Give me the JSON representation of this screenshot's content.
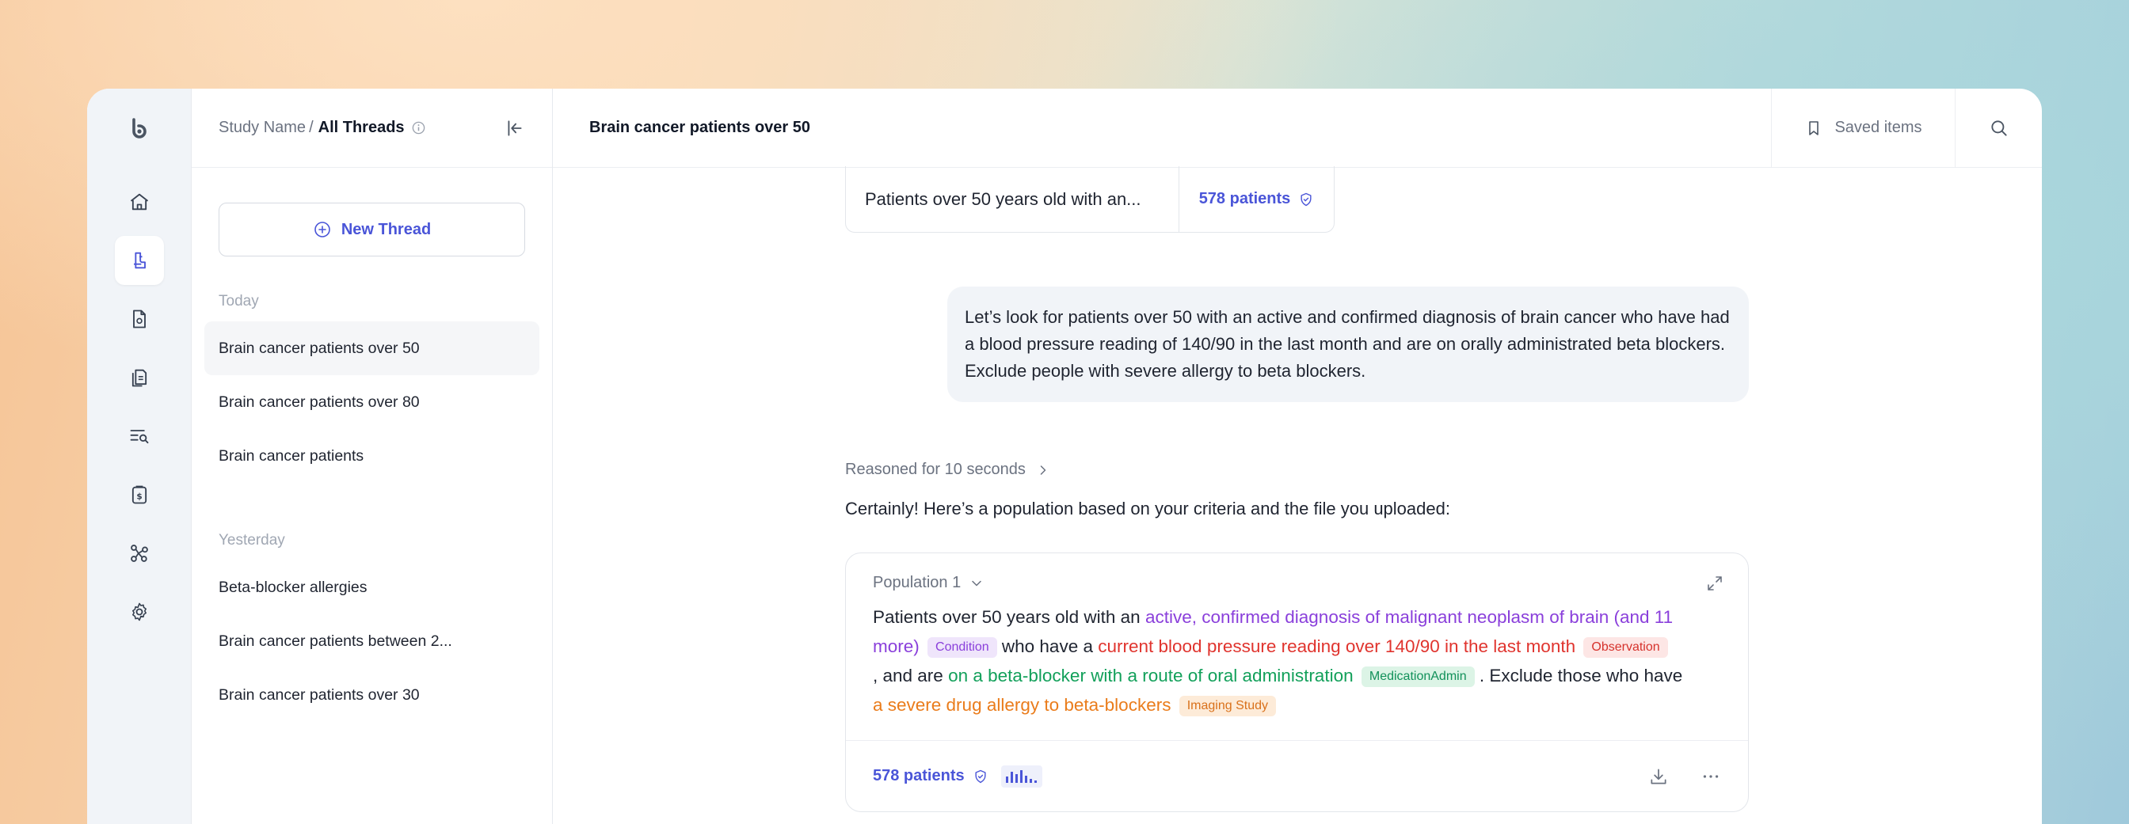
{
  "breadcrumb": {
    "study": "Study Name",
    "separator": "/",
    "current": "All Threads"
  },
  "threads": {
    "new_thread_label": "New Thread",
    "today_label": "Today",
    "yesterday_label": "Yesterday",
    "today": [
      {
        "label": "Brain cancer patients over 50"
      },
      {
        "label": "Brain cancer patients over 80"
      },
      {
        "label": "Brain cancer patients"
      }
    ],
    "yesterday": [
      {
        "label": "Beta-blocker allergies"
      },
      {
        "label": "Brain cancer patients between 2..."
      },
      {
        "label": "Brain cancer patients over 30"
      }
    ]
  },
  "header": {
    "title": "Brain cancer patients over 50",
    "saved_label": "Saved items"
  },
  "chat": {
    "prev_population": {
      "text": "Patients over 50 years old with an...",
      "count": "578 patients"
    },
    "user_message": "Let’s look for patients over 50 with an active and confirmed diagnosis of brain cancer who have had a blood pressure reading of 140/90 in the last month and are on orally administrated beta blockers. Exclude people with severe allergy to beta blockers.",
    "reasoned": "Reasoned for 10 seconds",
    "answer": "Certainly! Here’s a population based on your criteria and the file you uploaded:",
    "population": {
      "title": "Population 1",
      "t1": "Patients over 50 years old with an ",
      "c1": "active, confirmed diagnosis of malignant neoplasm of brain (and 11 more)",
      "tag1": "Condition",
      "t2": " who have a ",
      "c2": "current blood pressure reading over 140/90 in the last month",
      "tag2": "Observation",
      "t3": ", and are ",
      "c3": "on a beta-blocker with a route of oral administration",
      "tag3": "MedicationAdmin",
      "t4": " . Exclude those who have ",
      "c4": "a severe drug allergy to beta-blockers",
      "tag4": "Imaging Study",
      "count": "578 patients"
    }
  },
  "colors": {
    "accent": "#4a55d8",
    "purple": "#8a3fdb",
    "red": "#e0342e",
    "green": "#12a05a",
    "orange": "#ea7c1b"
  },
  "icons": [
    "logo-icon",
    "home-icon",
    "studies-icon",
    "document-icon",
    "files-icon",
    "search-list-icon",
    "billing-icon",
    "network-icon",
    "settings-icon",
    "info-icon",
    "collapse-icon",
    "plus-circle-icon",
    "bookmark-icon",
    "search-icon",
    "chevron-right-icon",
    "chevron-down-icon",
    "expand-icon",
    "shield-check-icon",
    "histogram-icon",
    "download-icon",
    "more-icon"
  ]
}
